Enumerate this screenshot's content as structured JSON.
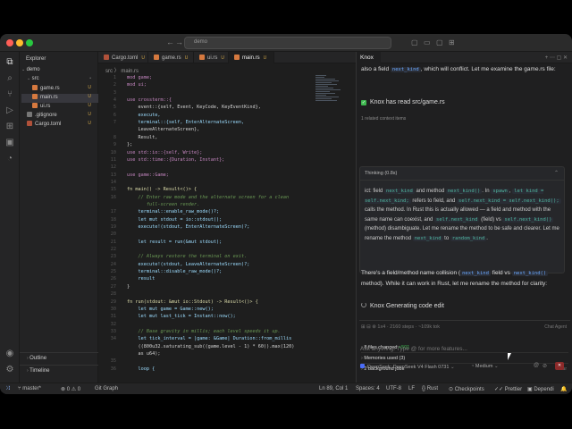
{
  "titlebar": {
    "search_text": "demo",
    "nav_back": "←",
    "nav_fwd": "→"
  },
  "explorer": {
    "title": "Explorer",
    "root": "demo",
    "items": [
      {
        "label": "src",
        "badge": "•",
        "type": "folder",
        "color": "#8a8a8a"
      },
      {
        "label": "game.rs",
        "badge": "U",
        "type": "file",
        "color": "#d6793f"
      },
      {
        "label": "main.rs",
        "badge": "U",
        "type": "file",
        "color": "#d6793f"
      },
      {
        "label": "ui.rs",
        "badge": "U",
        "type": "file",
        "color": "#d6793f"
      },
      {
        "label": ".gitignore",
        "badge": "U",
        "type": "file",
        "color": "#777777"
      },
      {
        "label": "Cargo.toml",
        "badge": "U",
        "type": "file",
        "color": "#b0513a"
      }
    ],
    "outline": "Outline",
    "timeline": "Timeline"
  },
  "tabs": [
    {
      "label": "Cargo.toml",
      "badge": "U"
    },
    {
      "label": "game.rs",
      "badge": "U"
    },
    {
      "label": "ui.rs",
      "badge": "U"
    },
    {
      "label": "main.rs",
      "badge": "U",
      "active": true
    }
  ],
  "breadcrumb": "src 〉 main.rs",
  "code_lines": [
    "mod game;",
    "mod ui;",
    "",
    "use crossterm::{",
    "    event::{self, Event, KeyCode, KeyEventKind},",
    "    execute,",
    "    terminal::{self, EnterAlternateScreen,",
    "    LeaveAlternateScreen},",
    "    Result,",
    "};",
    "use std::io::{self, Write};",
    "use std::time::{Duration, Instant};",
    "",
    "use game::Game;",
    "",
    "fn main() -> Result<()> {",
    "    // Enter raw mode and the alternate screen for a clean",
    "       full-screen render.",
    "    terminal::enable_raw_mode()?;",
    "    let mut stdout = io::stdout();",
    "    execute!(stdout, EnterAlternateScreen)?;",
    "",
    "    let result = run(&mut stdout);",
    "",
    "    // Always restore the terminal on exit.",
    "    execute!(stdout, LeaveAlternateScreen)?;",
    "    terminal::disable_raw_mode()?;",
    "    result",
    "}",
    "",
    "fn run(stdout: &mut io::Stdout) -> Result<()> {",
    "    let mut game = Game::new();",
    "    let mut last_tick = Instant::now();",
    "",
    "    // Base gravity in millis; each level speeds it up.",
    "    let tick_interval = |game: &Game| Duration::from_millis",
    "    ((800u32.saturating_sub((game.level - 1) * 60)).max(120)",
    "    as u64);",
    "",
    "    loop {"
  ],
  "code_line_numbers": [
    "1",
    "2",
    "3",
    "4",
    "5",
    "6",
    "7",
    "",
    "8",
    "9",
    "10",
    "11",
    "12",
    "13",
    "14",
    "15",
    "16",
    "",
    "17",
    "18",
    "19",
    "20",
    "21",
    "22",
    "23",
    "24",
    "25",
    "26",
    "27",
    "28",
    "29",
    "30",
    "31",
    "32",
    "33",
    "34",
    "",
    "",
    "35",
    "36"
  ],
  "chat": {
    "tab_label": "Knox",
    "intro": "also a field",
    "intro_code": "next_kind",
    "intro_rest": ", which will conflict. Let me examine the game.rs file:",
    "read_status": "Knox has read src/game.rs",
    "related": "1 related context items",
    "thinking_label": "Thinking (0.8s)",
    "thinking_body": [
      {
        "t": "ict: field "
      },
      {
        "c": "next_kind"
      },
      {
        "t": " and method "
      },
      {
        "c": "next_kind()"
      },
      {
        "t": ". In "
      },
      {
        "c": "spawn"
      },
      {
        "t": ", "
      },
      {
        "c": "let kind = self.next_kind;"
      },
      {
        "t": " refers to field, and "
      },
      {
        "c": "self.next_kind = self.next_kind();"
      },
      {
        "t": " calls the method. In Rust this is actually allowed — a field and method with the same name can coexist, and "
      },
      {
        "c": "self.next_kind"
      },
      {
        "t": " (field) vs "
      },
      {
        "c": "self.next_kind()"
      },
      {
        "t": " (method) disambiguate. Let me rename the method to be safe and clearer. Let me rename the method "
      },
      {
        "c": "next_kind"
      },
      {
        "t": " to "
      },
      {
        "c": "random_kind"
      },
      {
        "t": "."
      }
    ],
    "summary_a": "There's a field/method name collision (",
    "summary_c1": "next_kind",
    "summary_b": " field vs ",
    "summary_c2": "next_kind()",
    "summary_c": " method). While it can work in Rust, let me rename the method for clarity:",
    "generating": "Knox Generating code edit",
    "panel_header": "1x4 · 2160 steps · ~109k tok",
    "panel_buttons": "Chat   Agent",
    "files_changed": "8 files changed",
    "files_plus": "+501",
    "memories": "Memories used (3)",
    "bg_jobs": "2 background jobs",
    "clear": "Clear",
    "placeholder": "Ask anything! Type @ for more features...",
    "model": "DeepSeek: DeepSeek V4 Flash 0731",
    "effort": "Medium"
  },
  "statusbar": {
    "branch": "master*",
    "problems": "⊗ 0 ⚠ 0",
    "git": "Git Graph",
    "position": "Ln 89, Col 1",
    "spaces": "Spaces: 4",
    "encoding": "UTF-8",
    "eol": "LF",
    "lang": "Rust",
    "checkpoints": "Checkpoints",
    "prettier": "Prettier",
    "deps": "Dependi"
  }
}
